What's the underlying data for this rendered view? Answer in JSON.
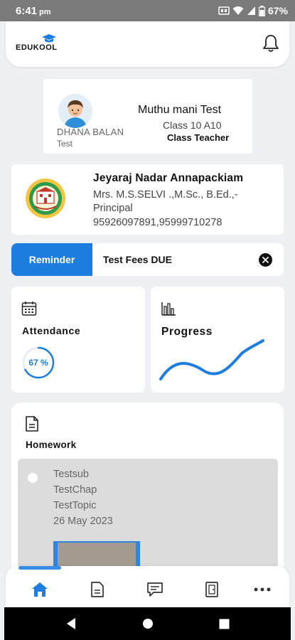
{
  "status_bar": {
    "time": "6:41",
    "ampm": "pm",
    "battery": "67%",
    "icons": [
      "sim-icon",
      "wifi-icon",
      "signal-icon",
      "battery-icon"
    ]
  },
  "header": {
    "logo_text": "EDUKOOL",
    "bell_icon": "bell-icon"
  },
  "teacher_card": {
    "teacher_name": "Muthu mani Test",
    "class_label": "Class 10  A10",
    "role": "Class Teacher",
    "student_name": "DHANA BALAN",
    "student_sub": "Test"
  },
  "school": {
    "name": "Jeyaraj Nadar Annapackiam",
    "principal": "Mrs. M.S.SELVI .,M.Sc., B.Ed.,-",
    "role": "Principal",
    "phones": "95926097891,95999710278"
  },
  "reminder": {
    "tag": "Reminder",
    "text": "Test Fees DUE"
  },
  "attendance": {
    "label": "Attendance",
    "value_text": "67 %",
    "percent": 67
  },
  "progress": {
    "label": "Progress"
  },
  "homework": {
    "label": "Homework",
    "items": [
      {
        "subject": "Testsub",
        "chapter": "TestChap",
        "topic": "TestTopic",
        "date": "26 May 2023"
      }
    ]
  },
  "bottom_nav": {
    "items": [
      "home-icon",
      "document-icon",
      "chat-icon",
      "door-icon",
      "more-icon"
    ]
  },
  "colors": {
    "accent": "#1e7ee0",
    "status_bar": "#7a7a7a",
    "background": "#eef0f3"
  }
}
